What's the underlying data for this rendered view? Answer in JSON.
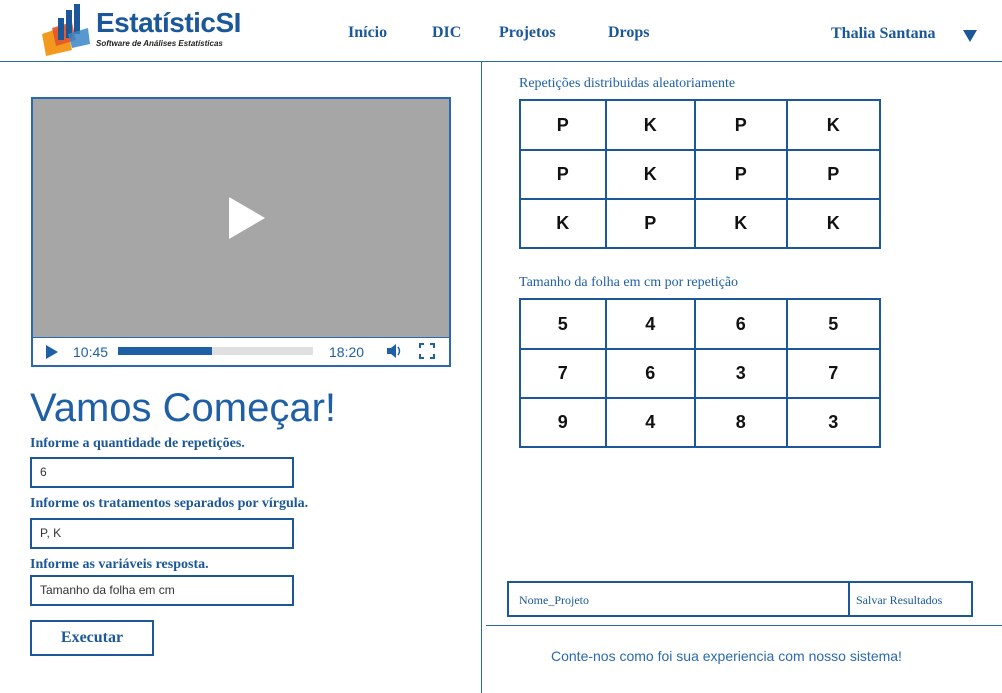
{
  "header": {
    "logo_name": "EstatísticSI",
    "logo_tagline": "Software de Análises Estatísticas",
    "nav": [
      {
        "label": "Início"
      },
      {
        "label": "DIC"
      },
      {
        "label": "Projetos"
      },
      {
        "label": "Drops"
      }
    ],
    "user_name": "Thalia Santana",
    "user_menu_icon": "caret-down-icon"
  },
  "video": {
    "current_time": "10:45",
    "duration": "18:20",
    "progress_percent": 48,
    "icons": [
      "play-icon",
      "volume-icon",
      "fullscreen-icon"
    ]
  },
  "form": {
    "heading": "Vamos Começar!",
    "repetitions_label": "Informe a quantidade de repetições.",
    "repetitions_value": "6",
    "treatments_label": "Informe os tratamentos separados por vírgula.",
    "treatments_value": "P, K",
    "response_label": "Informe as variáveis resposta.",
    "response_value": "Tamanho da folha em cm",
    "execute_label": "Executar"
  },
  "randomized": {
    "title": "Repetições distribuidas aleatoriamente",
    "rows": [
      [
        "P",
        "K",
        "P",
        "K"
      ],
      [
        "P",
        "K",
        "P",
        "P"
      ],
      [
        "K",
        "P",
        "K",
        "K"
      ]
    ]
  },
  "sizes": {
    "title": "Tamanho da folha em cm por repetição",
    "rows": [
      [
        "5",
        "4",
        "6",
        "5"
      ],
      [
        "7",
        "6",
        "3",
        "7"
      ],
      [
        "9",
        "4",
        "8",
        "3"
      ]
    ]
  },
  "save": {
    "project_name": "Nome_Projeto",
    "save_label": "Salvar Resultados"
  },
  "feedback_text": "Conte-nos como foi sua experiencia com nosso sistema!",
  "colors": {
    "brand_blue": "#1b5799",
    "accent_blue": "#2a69ac",
    "video_bg": "#a6a6a6"
  }
}
